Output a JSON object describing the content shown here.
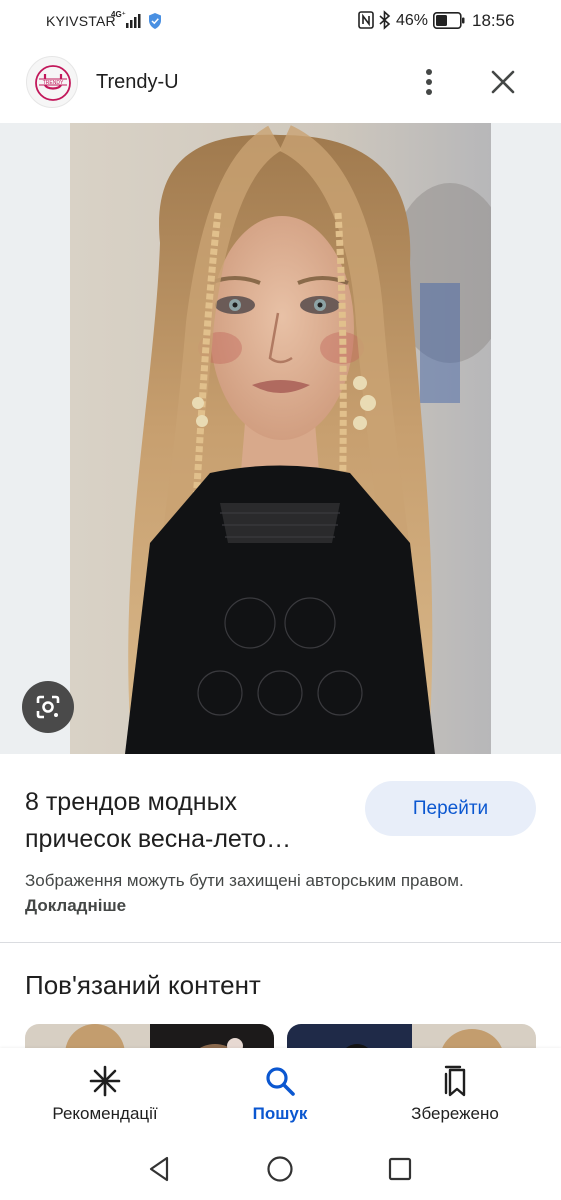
{
  "status_bar": {
    "carrier": "KYIVSTAR",
    "network": "4G⁺",
    "battery_percent": "46%",
    "time": "18:56"
  },
  "header": {
    "site_name": "Trendy-U",
    "logo_icon": "trendy-u-logo",
    "more_icon": "more-vert-icon",
    "close_icon": "close-icon"
  },
  "image": {
    "lens_icon": "google-lens-icon"
  },
  "result": {
    "title_line1": "8 трендов модных",
    "title_line2": "причесок весна-лето…",
    "visit_label": "Перейти",
    "copyright_text": "Зображення можуть бути захищені авторським правом.",
    "learn_more": "Докладніше"
  },
  "related": {
    "heading": "Пов'язаний контент"
  },
  "bottom_nav": {
    "items": [
      {
        "label": "Рекомендації",
        "icon": "discover-asterisk-icon",
        "active": false
      },
      {
        "label": "Пошук",
        "icon": "search-icon",
        "active": true
      },
      {
        "label": "Збережено",
        "icon": "saved-bookmarks-icon",
        "active": false
      }
    ]
  },
  "colors": {
    "accent": "#0b57d0",
    "visit_button_bg": "#e8eef9",
    "text_primary": "#1f1f1f",
    "text_secondary": "#444746"
  }
}
